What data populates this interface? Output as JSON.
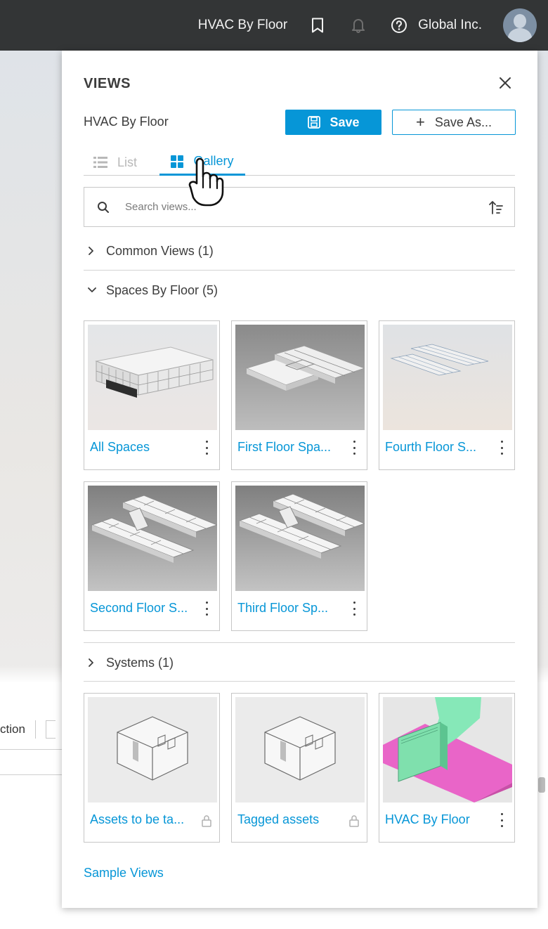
{
  "topbar": {
    "model_name": "HVAC By Floor",
    "company": "Global Inc.",
    "icons": [
      "bookmark-icon",
      "bell-icon",
      "help-icon",
      "avatar"
    ]
  },
  "background": {
    "toolbar_fragment": "ction"
  },
  "panel": {
    "title": "VIEWS",
    "current_view": "HVAC By Floor",
    "save_label": "Save",
    "save_as_label": "Save As...",
    "tabs": [
      {
        "label": "List",
        "active": false
      },
      {
        "label": "Gallery",
        "active": true
      }
    ],
    "search": {
      "placeholder": "Search views..."
    },
    "groups": [
      {
        "label": "Common Views (1)",
        "expanded": false
      },
      {
        "label": "Spaces By Floor (5)",
        "expanded": true,
        "items": [
          {
            "label": "All Spaces",
            "locked": false
          },
          {
            "label": "First Floor Spa...",
            "locked": false
          },
          {
            "label": "Fourth Floor S...",
            "locked": false
          },
          {
            "label": "Second Floor S...",
            "locked": false
          },
          {
            "label": "Third Floor Sp...",
            "locked": false
          }
        ]
      },
      {
        "label": "Systems (1)",
        "expanded": false
      },
      {
        "label": "",
        "expanded": true,
        "items": [
          {
            "label": "Assets to be ta...",
            "locked": true
          },
          {
            "label": "Tagged assets",
            "locked": true
          },
          {
            "label": "HVAC By Floor",
            "locked": false
          }
        ]
      }
    ],
    "sample_views_link": "Sample Views"
  },
  "colors": {
    "accent": "#0696d7",
    "topbar_bg": "#333536",
    "hvac_pink": "#e965c8",
    "hvac_green": "#7fe8b3"
  }
}
